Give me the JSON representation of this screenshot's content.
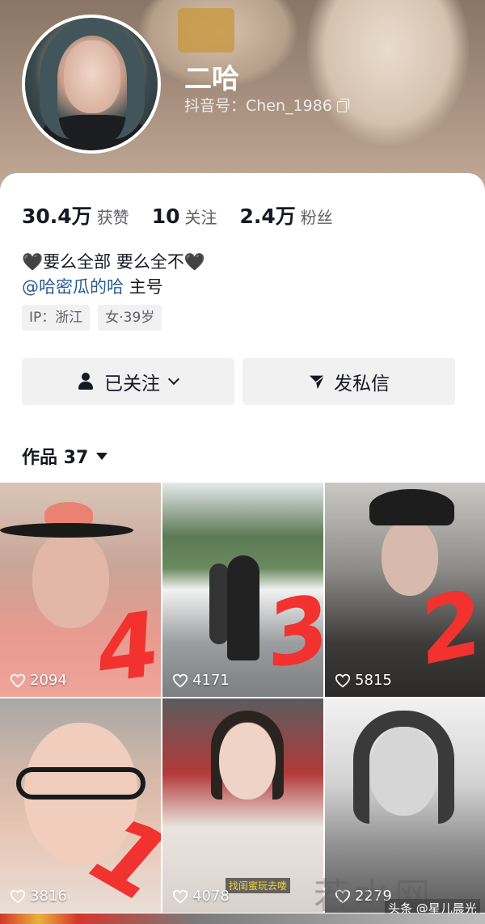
{
  "profile": {
    "nickname": "二哈",
    "douyin_id_label": "抖音号：Chen_1986",
    "bio_text": "🖤要么全部 要么全不🖤",
    "bio_mention": "@哈密瓜的哈",
    "bio_mention_suffix": " 主号",
    "tags": [
      "IP：浙江",
      "女·39岁"
    ]
  },
  "stats": {
    "likes_num": "30.4万",
    "likes_label": "获赞",
    "following_num": "10",
    "following_label": "关注",
    "followers_num": "2.4万",
    "followers_label": "粉丝"
  },
  "actions": {
    "follow_label": "已关注",
    "message_label": "发私信"
  },
  "works": {
    "tab_label": "作品 37"
  },
  "videos": [
    {
      "likes": "2094",
      "overlay_number": "4"
    },
    {
      "likes": "4171",
      "overlay_number": "3"
    },
    {
      "likes": "5815",
      "overlay_number": "2"
    },
    {
      "likes": "3816",
      "overlay_number": "1"
    },
    {
      "likes": "4078",
      "caption": "找闺蜜玩去喽"
    },
    {
      "likes": "2279"
    }
  ],
  "watermarks": {
    "big": "若水网",
    "small": "头条 @星儿晨光"
  },
  "colors": {
    "mention": "#2a5c8f",
    "overlay_number": "#f1322f"
  }
}
